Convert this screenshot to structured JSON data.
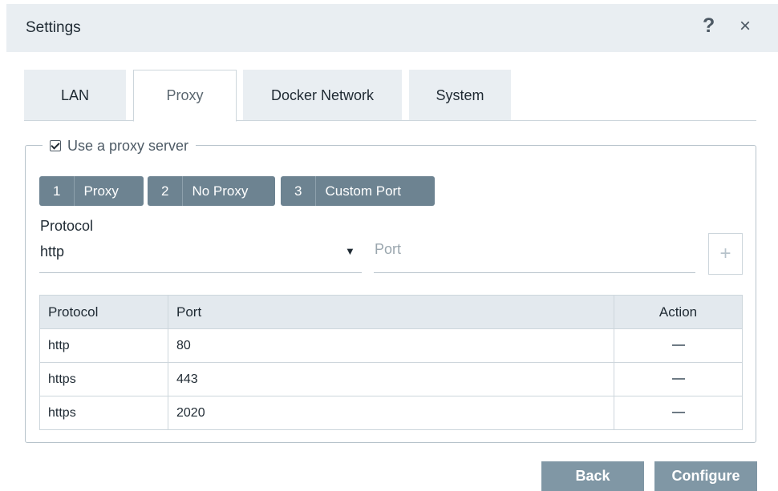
{
  "dialog": {
    "title": "Settings",
    "help_glyph": "?",
    "close_glyph": "×"
  },
  "tabs": [
    {
      "label": "LAN",
      "active": false
    },
    {
      "label": "Proxy",
      "active": true
    },
    {
      "label": "Docker Network",
      "active": false
    },
    {
      "label": "System",
      "active": false
    }
  ],
  "proxy": {
    "use_proxy_label": "Use a proxy server",
    "use_proxy_checked": true,
    "steps": [
      {
        "num": "1",
        "label": "Proxy"
      },
      {
        "num": "2",
        "label": "No Proxy"
      },
      {
        "num": "3",
        "label": "Custom Port"
      }
    ],
    "protocol_label": "Protocol",
    "protocol_value": "http",
    "caret_glyph": "▼",
    "port_placeholder": "Port",
    "add_glyph": "+",
    "table": {
      "headers": [
        "Protocol",
        "Port",
        "Action"
      ],
      "rows": [
        {
          "protocol": "http",
          "port": "80"
        },
        {
          "protocol": "https",
          "port": "443"
        },
        {
          "protocol": "https",
          "port": "2020"
        }
      ]
    }
  },
  "footer": {
    "back_label": "Back",
    "configure_label": "Configure"
  },
  "colors": {
    "titlebar_bg": "#e9eef2",
    "step_bg": "#6d8391",
    "button_bg": "#8097a5"
  },
  "icons": {
    "help": "question-mark-icon",
    "close": "close-icon",
    "dropdown": "chevron-down-icon",
    "add": "plus-icon",
    "remove": "minus-icon"
  }
}
